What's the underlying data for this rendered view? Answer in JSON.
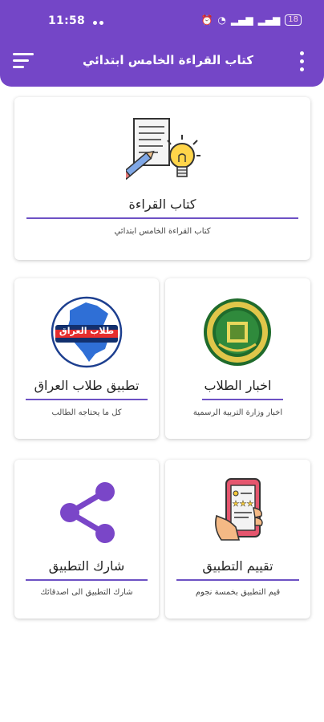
{
  "status_bar": {
    "time": "11:58",
    "battery": "18"
  },
  "app_bar": {
    "title": "كتاب القراءة الخامس ابتدائي"
  },
  "cards": {
    "book": {
      "title": "كتاب القراءة",
      "subtitle": "كتاب القراءة الخامس ابتدائي"
    },
    "iraq_app": {
      "title": "تطبيق طلاب العراق",
      "subtitle": "كل ما يحتاجه الطالب",
      "logo_text": "طلاب العراق"
    },
    "news": {
      "title": "اخبار الطلاب",
      "subtitle": "اخبار وزارة التربية الرسمية"
    },
    "share": {
      "title": "شارك التطبيق",
      "subtitle": "شارك التطبيق الى اصدقائك"
    },
    "rate": {
      "title": "تقييم التطبيق",
      "subtitle": "قيم التطبيق بخمسة نجوم"
    }
  },
  "colors": {
    "primary": "#7446c7",
    "accent_line": "#6d51c4",
    "share_icon": "#7a46c8"
  }
}
